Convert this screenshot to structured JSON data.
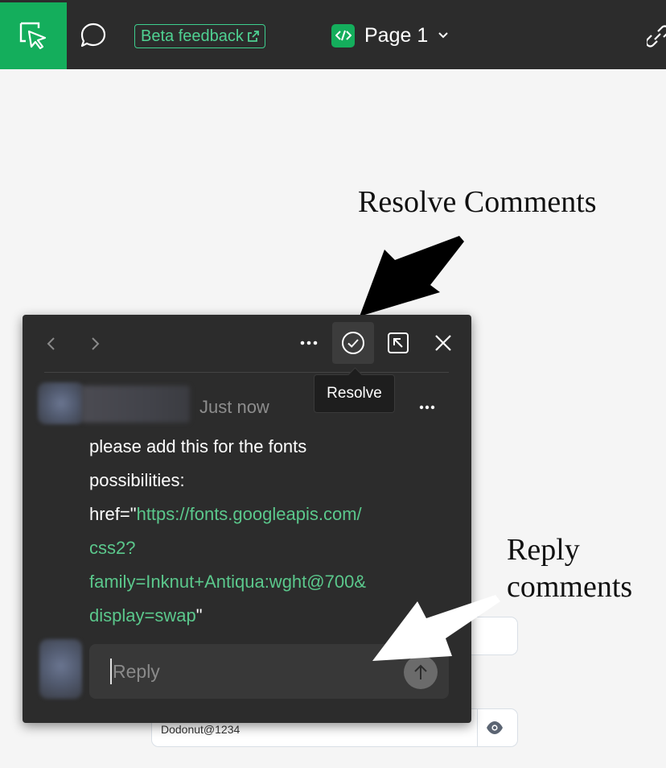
{
  "toolbar": {
    "beta_feedback_label": "Beta feedback",
    "page_label": "Page 1",
    "accent": "#14ae5c"
  },
  "annotations": {
    "resolve": "Resolve Comments",
    "reply_line1": "Reply",
    "reply_line2": "comments"
  },
  "comment": {
    "timestamp": "Just now",
    "tooltip": "Resolve",
    "body_line1": "please add this for the fonts",
    "body_line2": "possibilities:",
    "href_prefix": "href=\"",
    "link_line1": "https://fonts.googleapis.com/",
    "link_line2": "css2?",
    "link_line3": "family=Inknut+Antiqua:wght@700&",
    "link_line4": "display=swap",
    "href_suffix": "\"",
    "reply_placeholder": "Reply"
  },
  "background_form": {
    "password_value": "Dodonut@1234"
  },
  "icons": [
    "select-tool-icon",
    "comment-icon",
    "external-link-icon",
    "code-icon",
    "chevron-down-icon",
    "link-icon",
    "chevron-left-icon",
    "chevron-right-icon",
    "more-icon",
    "check-circle-icon",
    "open-panel-icon",
    "close-icon",
    "send-arrow-icon",
    "eye-icon"
  ]
}
